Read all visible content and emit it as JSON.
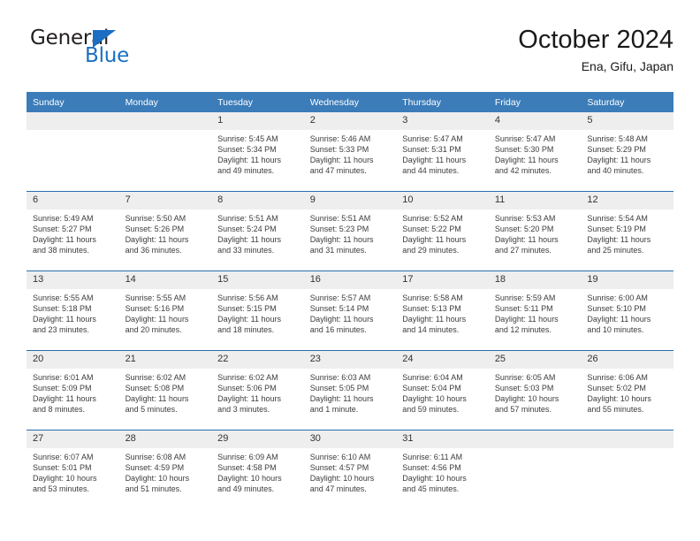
{
  "brand": {
    "name_dark": "General",
    "name_blue": "Blue",
    "triangle_color": "#1b6ec2"
  },
  "header": {
    "title": "October 2024",
    "subtitle": "Ena, Gifu, Japan"
  },
  "theme": {
    "header_blue": "#3b7cb9",
    "row_rule_blue": "#2a6ead",
    "daynum_bg": "#eeeeee",
    "text": "#3c3c3c"
  },
  "weekdays": [
    "Sunday",
    "Monday",
    "Tuesday",
    "Wednesday",
    "Thursday",
    "Friday",
    "Saturday"
  ],
  "labels": {
    "sunrise": "Sunrise:",
    "sunset": "Sunset:",
    "daylight": "Daylight:"
  },
  "weeks": [
    [
      {
        "day": ""
      },
      {
        "day": ""
      },
      {
        "day": "1",
        "sunrise": "Sunrise: 5:45 AM",
        "sunset": "Sunset: 5:34 PM",
        "daylight1": "Daylight: 11 hours",
        "daylight2": "and 49 minutes."
      },
      {
        "day": "2",
        "sunrise": "Sunrise: 5:46 AM",
        "sunset": "Sunset: 5:33 PM",
        "daylight1": "Daylight: 11 hours",
        "daylight2": "and 47 minutes."
      },
      {
        "day": "3",
        "sunrise": "Sunrise: 5:47 AM",
        "sunset": "Sunset: 5:31 PM",
        "daylight1": "Daylight: 11 hours",
        "daylight2": "and 44 minutes."
      },
      {
        "day": "4",
        "sunrise": "Sunrise: 5:47 AM",
        "sunset": "Sunset: 5:30 PM",
        "daylight1": "Daylight: 11 hours",
        "daylight2": "and 42 minutes."
      },
      {
        "day": "5",
        "sunrise": "Sunrise: 5:48 AM",
        "sunset": "Sunset: 5:29 PM",
        "daylight1": "Daylight: 11 hours",
        "daylight2": "and 40 minutes."
      }
    ],
    [
      {
        "day": "6",
        "sunrise": "Sunrise: 5:49 AM",
        "sunset": "Sunset: 5:27 PM",
        "daylight1": "Daylight: 11 hours",
        "daylight2": "and 38 minutes."
      },
      {
        "day": "7",
        "sunrise": "Sunrise: 5:50 AM",
        "sunset": "Sunset: 5:26 PM",
        "daylight1": "Daylight: 11 hours",
        "daylight2": "and 36 minutes."
      },
      {
        "day": "8",
        "sunrise": "Sunrise: 5:51 AM",
        "sunset": "Sunset: 5:24 PM",
        "daylight1": "Daylight: 11 hours",
        "daylight2": "and 33 minutes."
      },
      {
        "day": "9",
        "sunrise": "Sunrise: 5:51 AM",
        "sunset": "Sunset: 5:23 PM",
        "daylight1": "Daylight: 11 hours",
        "daylight2": "and 31 minutes."
      },
      {
        "day": "10",
        "sunrise": "Sunrise: 5:52 AM",
        "sunset": "Sunset: 5:22 PM",
        "daylight1": "Daylight: 11 hours",
        "daylight2": "and 29 minutes."
      },
      {
        "day": "11",
        "sunrise": "Sunrise: 5:53 AM",
        "sunset": "Sunset: 5:20 PM",
        "daylight1": "Daylight: 11 hours",
        "daylight2": "and 27 minutes."
      },
      {
        "day": "12",
        "sunrise": "Sunrise: 5:54 AM",
        "sunset": "Sunset: 5:19 PM",
        "daylight1": "Daylight: 11 hours",
        "daylight2": "and 25 minutes."
      }
    ],
    [
      {
        "day": "13",
        "sunrise": "Sunrise: 5:55 AM",
        "sunset": "Sunset: 5:18 PM",
        "daylight1": "Daylight: 11 hours",
        "daylight2": "and 23 minutes."
      },
      {
        "day": "14",
        "sunrise": "Sunrise: 5:55 AM",
        "sunset": "Sunset: 5:16 PM",
        "daylight1": "Daylight: 11 hours",
        "daylight2": "and 20 minutes."
      },
      {
        "day": "15",
        "sunrise": "Sunrise: 5:56 AM",
        "sunset": "Sunset: 5:15 PM",
        "daylight1": "Daylight: 11 hours",
        "daylight2": "and 18 minutes."
      },
      {
        "day": "16",
        "sunrise": "Sunrise: 5:57 AM",
        "sunset": "Sunset: 5:14 PM",
        "daylight1": "Daylight: 11 hours",
        "daylight2": "and 16 minutes."
      },
      {
        "day": "17",
        "sunrise": "Sunrise: 5:58 AM",
        "sunset": "Sunset: 5:13 PM",
        "daylight1": "Daylight: 11 hours",
        "daylight2": "and 14 minutes."
      },
      {
        "day": "18",
        "sunrise": "Sunrise: 5:59 AM",
        "sunset": "Sunset: 5:11 PM",
        "daylight1": "Daylight: 11 hours",
        "daylight2": "and 12 minutes."
      },
      {
        "day": "19",
        "sunrise": "Sunrise: 6:00 AM",
        "sunset": "Sunset: 5:10 PM",
        "daylight1": "Daylight: 11 hours",
        "daylight2": "and 10 minutes."
      }
    ],
    [
      {
        "day": "20",
        "sunrise": "Sunrise: 6:01 AM",
        "sunset": "Sunset: 5:09 PM",
        "daylight1": "Daylight: 11 hours",
        "daylight2": "and 8 minutes."
      },
      {
        "day": "21",
        "sunrise": "Sunrise: 6:02 AM",
        "sunset": "Sunset: 5:08 PM",
        "daylight1": "Daylight: 11 hours",
        "daylight2": "and 5 minutes."
      },
      {
        "day": "22",
        "sunrise": "Sunrise: 6:02 AM",
        "sunset": "Sunset: 5:06 PM",
        "daylight1": "Daylight: 11 hours",
        "daylight2": "and 3 minutes."
      },
      {
        "day": "23",
        "sunrise": "Sunrise: 6:03 AM",
        "sunset": "Sunset: 5:05 PM",
        "daylight1": "Daylight: 11 hours",
        "daylight2": "and 1 minute."
      },
      {
        "day": "24",
        "sunrise": "Sunrise: 6:04 AM",
        "sunset": "Sunset: 5:04 PM",
        "daylight1": "Daylight: 10 hours",
        "daylight2": "and 59 minutes."
      },
      {
        "day": "25",
        "sunrise": "Sunrise: 6:05 AM",
        "sunset": "Sunset: 5:03 PM",
        "daylight1": "Daylight: 10 hours",
        "daylight2": "and 57 minutes."
      },
      {
        "day": "26",
        "sunrise": "Sunrise: 6:06 AM",
        "sunset": "Sunset: 5:02 PM",
        "daylight1": "Daylight: 10 hours",
        "daylight2": "and 55 minutes."
      }
    ],
    [
      {
        "day": "27",
        "sunrise": "Sunrise: 6:07 AM",
        "sunset": "Sunset: 5:01 PM",
        "daylight1": "Daylight: 10 hours",
        "daylight2": "and 53 minutes."
      },
      {
        "day": "28",
        "sunrise": "Sunrise: 6:08 AM",
        "sunset": "Sunset: 4:59 PM",
        "daylight1": "Daylight: 10 hours",
        "daylight2": "and 51 minutes."
      },
      {
        "day": "29",
        "sunrise": "Sunrise: 6:09 AM",
        "sunset": "Sunset: 4:58 PM",
        "daylight1": "Daylight: 10 hours",
        "daylight2": "and 49 minutes."
      },
      {
        "day": "30",
        "sunrise": "Sunrise: 6:10 AM",
        "sunset": "Sunset: 4:57 PM",
        "daylight1": "Daylight: 10 hours",
        "daylight2": "and 47 minutes."
      },
      {
        "day": "31",
        "sunrise": "Sunrise: 6:11 AM",
        "sunset": "Sunset: 4:56 PM",
        "daylight1": "Daylight: 10 hours",
        "daylight2": "and 45 minutes."
      },
      {
        "day": ""
      },
      {
        "day": ""
      }
    ]
  ]
}
